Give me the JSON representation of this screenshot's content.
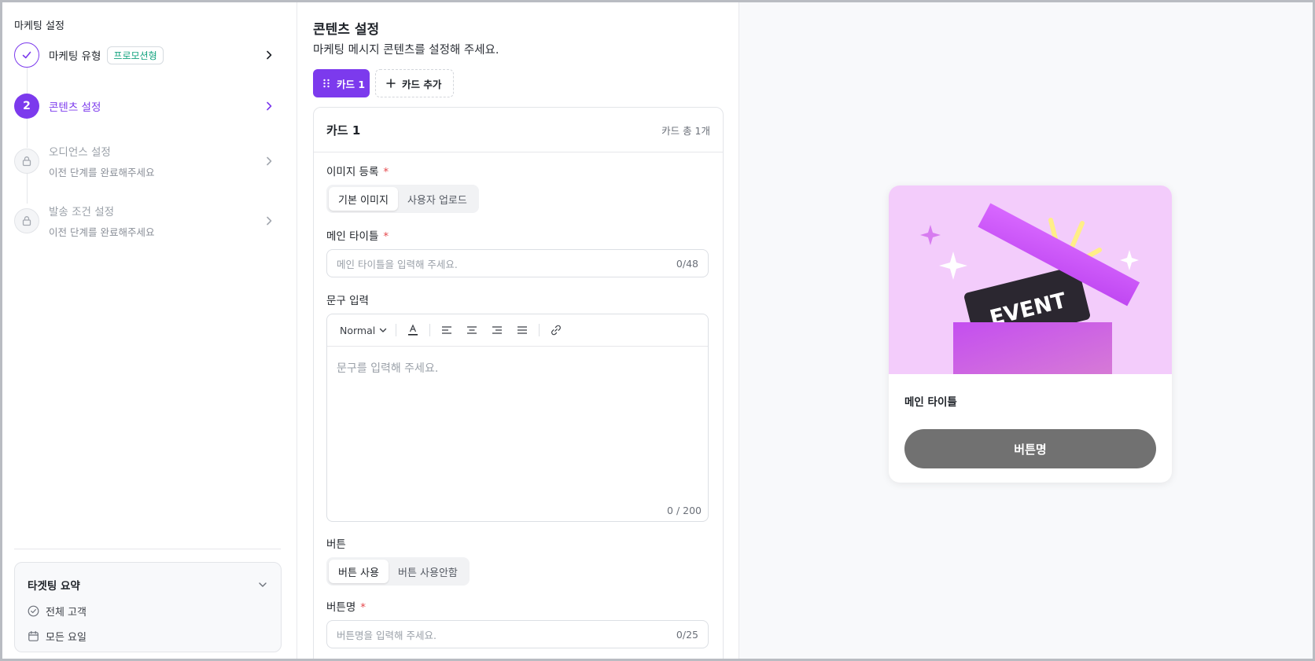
{
  "sidebar": {
    "title": "마케팅 설정",
    "steps": [
      {
        "label": "마케팅 유형",
        "badge": "프로모션형",
        "status": "done"
      },
      {
        "number": "2",
        "label": "콘텐츠 설정",
        "status": "active"
      },
      {
        "label": "오디언스 설정",
        "sub": "이전 단계를 완료해주세요",
        "status": "locked"
      },
      {
        "label": "발송 조건 설정",
        "sub": "이전 단계를 완료해주세요",
        "status": "locked"
      }
    ],
    "summary": {
      "title": "타겟팅 요약",
      "items": [
        "전체 고객",
        "모든 요일"
      ]
    }
  },
  "content": {
    "title": "콘텐츠 설정",
    "subtitle": "마케팅 메시지 콘텐츠를 설정해 주세요.",
    "tabs": {
      "active": "카드 1",
      "add": "카드 추가"
    },
    "card": {
      "name": "카드 1",
      "count": "카드 총 1개",
      "image": {
        "label": "이미지 등록",
        "required": "*",
        "options": [
          "기본 이미지",
          "사용자 업로드"
        ],
        "selected": "기본 이미지"
      },
      "main_title": {
        "label": "메인 타이틀",
        "required": "*",
        "placeholder": "메인 타이틀을 입력해 주세요.",
        "counter": "0/48"
      },
      "text": {
        "label": "문구 입력",
        "format": "Normal",
        "placeholder": "문구를 입력해 주세요.",
        "counter": "0 / 200"
      },
      "button": {
        "label": "버튼",
        "options": [
          "버튼 사용",
          "버튼 사용안함"
        ],
        "selected": "버튼 사용"
      },
      "button_name": {
        "label": "버튼명",
        "required": "*",
        "placeholder": "버튼명을 입력해 주세요.",
        "counter": "0/25"
      }
    }
  },
  "preview": {
    "image_text": "EVENT",
    "title": "메인 타이틀",
    "button": "버튼명"
  },
  "colors": {
    "accent": "#7c3aed",
    "badge_text": "#14a37f",
    "required": "#e5484d",
    "preview_button": "#717171"
  }
}
